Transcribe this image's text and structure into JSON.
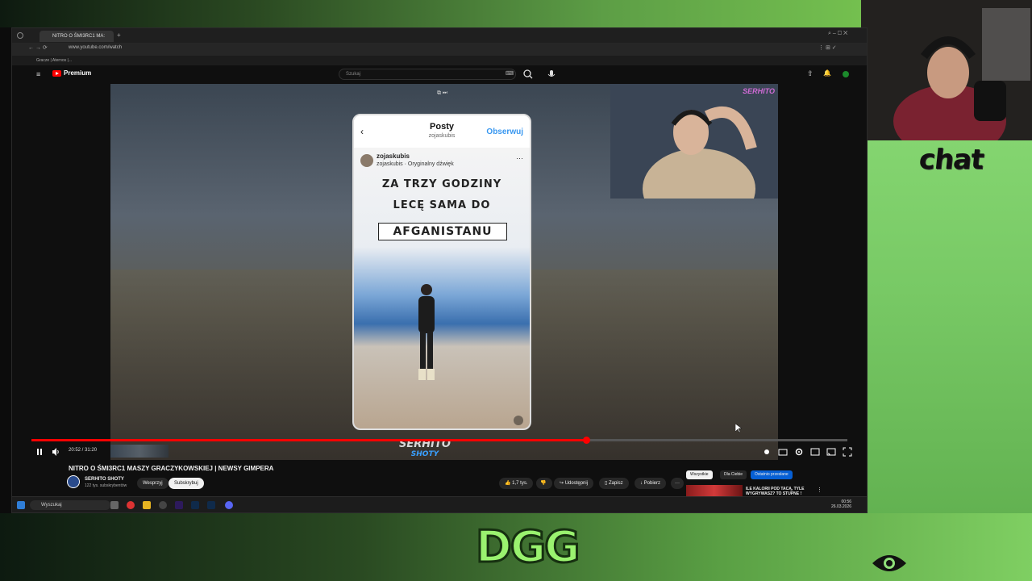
{
  "overlay": {
    "chat_label": "chat",
    "logo_text": "DGG"
  },
  "browser": {
    "tab_title": "NITRO O ŚMI3RC1 MA:",
    "url": "www.youtube.com/watch",
    "bookmark": "Gracze | Aternos |..."
  },
  "youtube": {
    "logo": "Premium",
    "search_placeholder": "Szukaj"
  },
  "reel": {
    "header_title": "Posty",
    "header_user": "zojaskubis",
    "follow_label": "Obserwuj",
    "user": "zojaskubis",
    "audio": "zojaskubis · Oryginalny dźwięk",
    "line1": "ZA TRZY GODZINY",
    "line2": "LECĘ SAMA DO",
    "line3": "AFGANISTANU"
  },
  "stream": {
    "cam_badge": "SERHITO",
    "watermark_main": "SERHITO",
    "watermark_sub": "SHOTY"
  },
  "player": {
    "time": "20:52 / 31:20",
    "progress": 0.68
  },
  "video_info": {
    "title": "NITRO O ŚMI3RC1 MASZY GRACZYKOWSKIEJ | NEWSY GIMPERA",
    "channel": "SERHITO SHOTY",
    "subs": "122 tys. subskrybentów",
    "support": "Wesprzyj",
    "subscribe": "Subskrybuj",
    "likes": "1,7 tys.",
    "share": "Udostępnij",
    "save": "Zapisz",
    "download": "Pobierz"
  },
  "sidebar": {
    "chips": [
      "Wszystkie",
      "Dla Ciebie",
      "Ostatnio przesłane"
    ],
    "rec_title": "ILE KALORII POD TACĄ, TYLE WYGRYWASZ? TO STUPNE !"
  },
  "taskbar": {
    "search": "Wyszukaj",
    "time": "00:56",
    "date": "26.03.2026"
  }
}
